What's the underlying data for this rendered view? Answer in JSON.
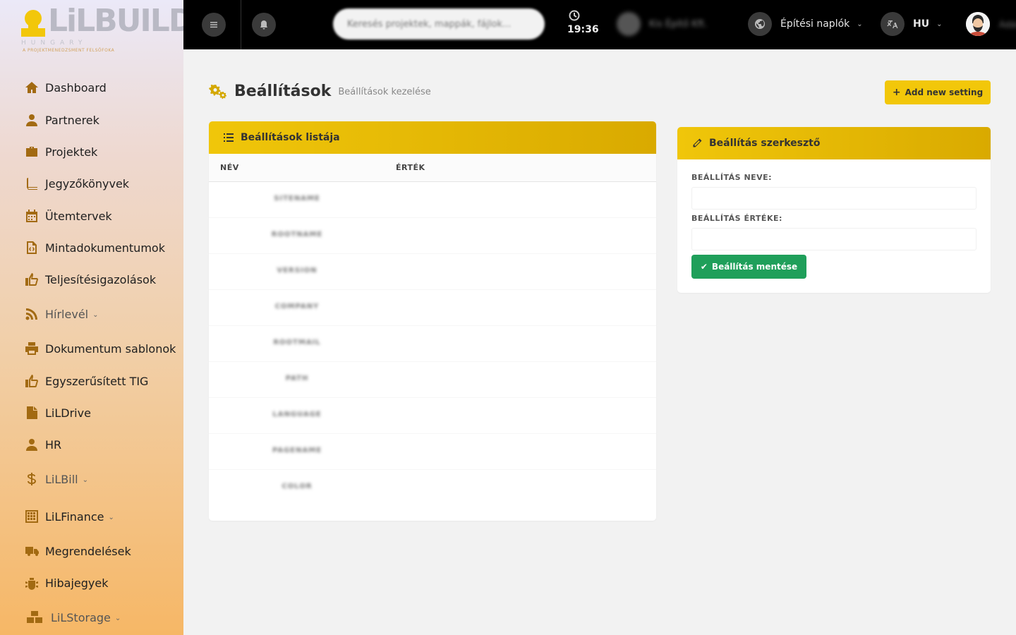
{
  "brand": {
    "logo_text": "LiLBUILD",
    "logo_sub": "HUNGARY",
    "logo_tag": "A PROJEKTMENEDZSMENT FELSŐFOKA"
  },
  "sidebar": {
    "items": [
      {
        "label": "Dashboard",
        "icon": "home-icon"
      },
      {
        "label": "Partnerek",
        "icon": "user-icon"
      },
      {
        "label": "Projektek",
        "icon": "briefcase-icon"
      },
      {
        "label": "Jegyzőkönyvek",
        "icon": "book-icon"
      },
      {
        "label": "Ütemtervek",
        "icon": "calendar-icon"
      },
      {
        "label": "Mintadokumentumok",
        "icon": "file-code-icon"
      },
      {
        "label": "Teljesítésigazolások",
        "icon": "thumbs-up-icon"
      },
      {
        "label": "Hírlevél",
        "icon": "rss-icon",
        "dropdown": true
      },
      {
        "label": "Dokumentum sablonok",
        "icon": "print-icon"
      },
      {
        "label": "Egyszerűsített TIG",
        "icon": "thumbs-up-icon"
      },
      {
        "label": "LiLDrive",
        "icon": "file-icon"
      },
      {
        "label": "HR",
        "icon": "user-icon"
      },
      {
        "label": "LiLBill",
        "icon": "dollar-icon",
        "dropdown": true
      },
      {
        "label": "LiLFinance",
        "icon": "calculator-icon",
        "dropdown": true
      },
      {
        "label": "Megrendelések",
        "icon": "truck-icon"
      },
      {
        "label": "Hibajegyek",
        "icon": "bug-icon"
      },
      {
        "label": "LiLStorage",
        "icon": "boxes-icon",
        "dropdown": true
      }
    ]
  },
  "topbar": {
    "search_placeholder": "Keresés projektek, mappák, fájlok...",
    "time": "19:36",
    "blurred_user": "Kis Építő Kft.",
    "site_selector": "Építési naplók",
    "language": "HU",
    "avatar_name": "Ádám"
  },
  "page": {
    "title": "Beállítások",
    "subtitle": "Beállítások kezelése",
    "add_button": "Add new setting"
  },
  "settings_list": {
    "title": "Beállítások listája",
    "columns": [
      "NÉV",
      "ÉRTÉK"
    ],
    "rows": [
      "SITENAME",
      "ROOTNAME",
      "VERSION",
      "COMPANY",
      "ROOTMAIL",
      "PATH",
      "LANGUAGE",
      "PAGENAME",
      "COLOR"
    ]
  },
  "editor": {
    "title": "Beállítás szerkesztő",
    "name_label": "BEÁLLÍTÁS NEVE:",
    "value_label": "BEÁLLÍTÁS ÉRTÉKE:",
    "save_button": "Beállítás mentése"
  },
  "colors": {
    "accent": "#f2c70a",
    "save": "#1f9f5a",
    "topbar": "#000000",
    "icon": "#a26a12"
  }
}
